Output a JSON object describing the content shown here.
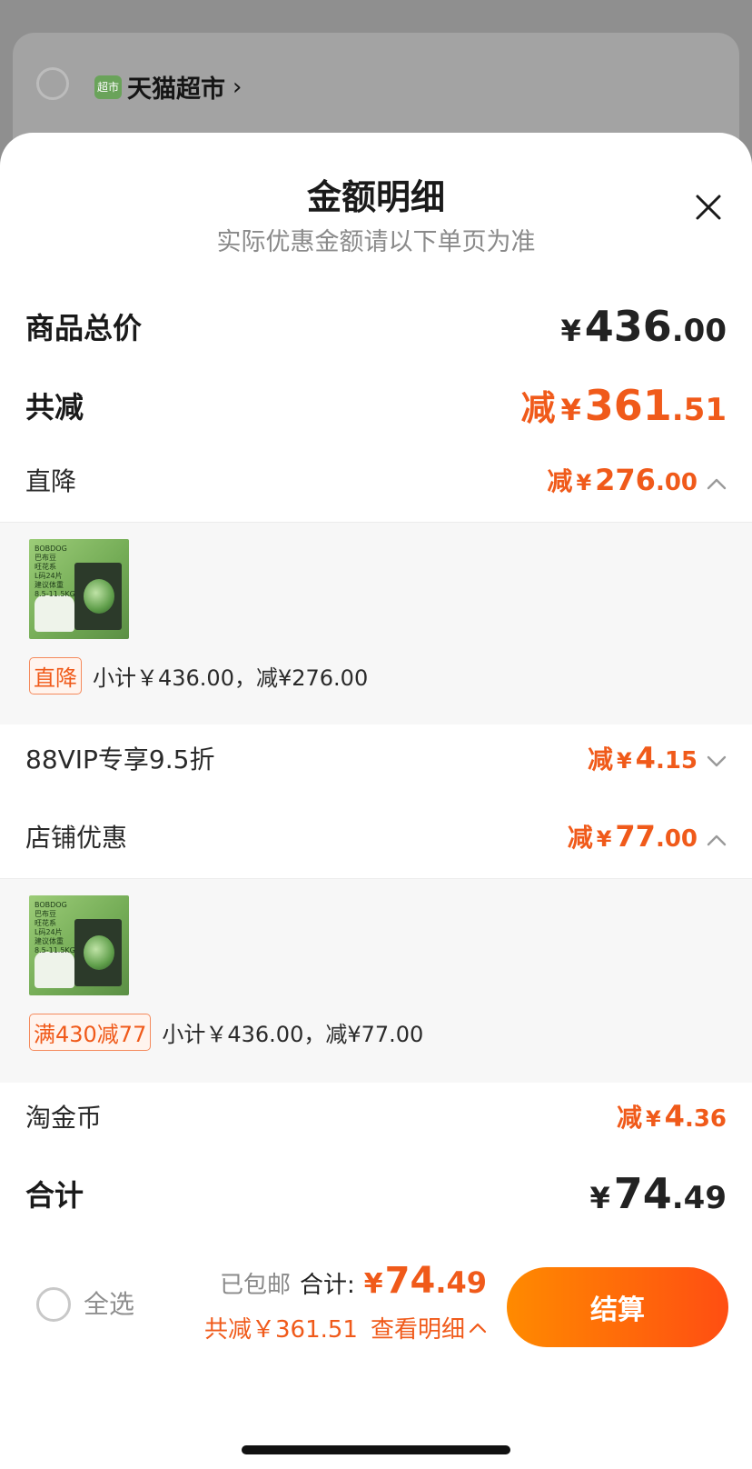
{
  "background": {
    "store_logo_text": "超市",
    "store_name": "天猫超市",
    "chevron": "›"
  },
  "sheet": {
    "title": "金额明细",
    "subtitle": "实际优惠金额请以下单页为准",
    "close_icon": "close-icon"
  },
  "rows": {
    "total_price": {
      "label": "商品总价",
      "currency": "¥",
      "int": "436",
      "dec": ".00"
    },
    "total_reduce": {
      "label": "共减",
      "prefix": "减",
      "currency": "¥",
      "int": "361",
      "dec": ".51"
    },
    "direct_reduce": {
      "label": "直降",
      "prefix": "减",
      "currency": "¥",
      "int": "276",
      "dec": ".00",
      "state": "expanded"
    },
    "vip": {
      "label": "88VIP专享9.5折",
      "prefix": "减",
      "currency": "¥",
      "int": "4",
      "dec": ".15",
      "state": "collapsed"
    },
    "store_discount": {
      "label": "店铺优惠",
      "prefix": "减",
      "currency": "¥",
      "int": "77",
      "dec": ".00",
      "state": "expanded"
    },
    "coins": {
      "label": "淘金币",
      "prefix": "减",
      "currency": "¥",
      "int": "4",
      "dec": ".36"
    },
    "grand_total": {
      "label": "合计",
      "currency": "¥",
      "int": "74",
      "dec": ".49"
    }
  },
  "details": {
    "direct": {
      "product_lines": [
        "BOBDOG",
        "巴布豆",
        "旺花系",
        "L码24片",
        "建议体重",
        "8.5-11.5KG"
      ],
      "tag": "直降",
      "text": "小计￥436.00，减¥276.00"
    },
    "store": {
      "product_lines": [
        "BOBDOG",
        "巴布豆",
        "旺花系",
        "L码24片",
        "建议体重",
        "8.5-11.5KG"
      ],
      "tag": "满430减77",
      "text": "小计￥436.00，减¥77.00"
    }
  },
  "bottom_bar": {
    "select_all": "全选",
    "shipping": "已包邮",
    "sum_label": "合计:",
    "sum_currency": "¥",
    "sum_int": "74",
    "sum_dec": ".49",
    "reduce_text": "共减￥361.51",
    "view_detail": "查看明细",
    "checkout": "结算"
  },
  "colors": {
    "accent": "#f05a1a",
    "button_start": "#ff8a00",
    "button_end": "#ff4e12",
    "overlay": "#8f8f8f"
  }
}
